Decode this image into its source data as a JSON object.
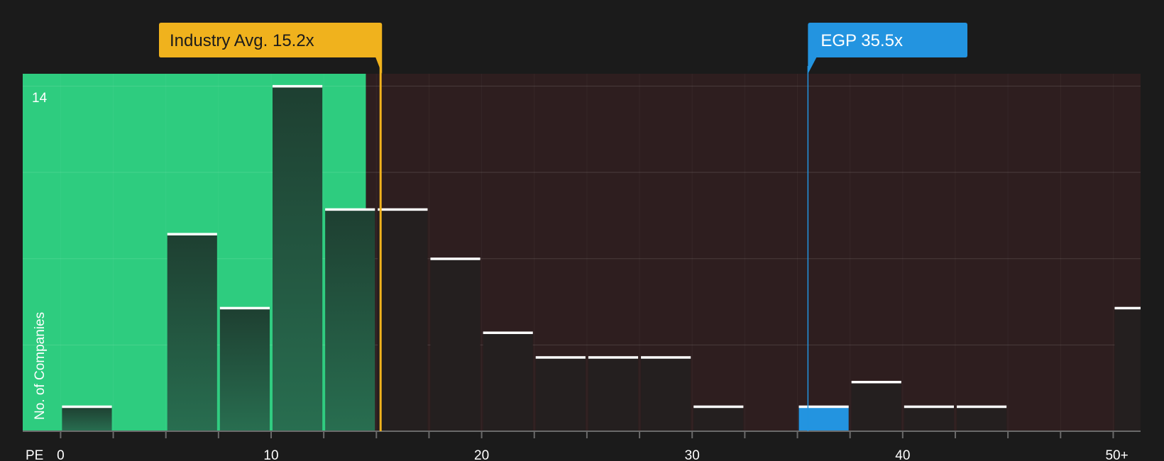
{
  "chart_data": {
    "type": "bar",
    "title": "",
    "xlabel": "PE",
    "ylabel": "No. of Companies",
    "x_ticks": [
      "0",
      "10",
      "20",
      "30",
      "40",
      "50+"
    ],
    "y_ticks": [
      "14"
    ],
    "ylim": [
      0,
      14.5
    ],
    "xlim": [
      -1.8,
      51.3
    ],
    "bin_width": 2.5,
    "bins": [
      {
        "start": 0,
        "value": 1
      },
      {
        "start": 2.5,
        "value": 0
      },
      {
        "start": 5,
        "value": 8
      },
      {
        "start": 7.5,
        "value": 5
      },
      {
        "start": 10,
        "value": 14
      },
      {
        "start": 12.5,
        "value": 9
      },
      {
        "start": 15,
        "value": 9
      },
      {
        "start": 17.5,
        "value": 7
      },
      {
        "start": 20,
        "value": 4
      },
      {
        "start": 22.5,
        "value": 3
      },
      {
        "start": 25,
        "value": 3
      },
      {
        "start": 27.5,
        "value": 3
      },
      {
        "start": 30,
        "value": 1
      },
      {
        "start": 32.5,
        "value": 0
      },
      {
        "start": 35,
        "value": 1,
        "highlight": true
      },
      {
        "start": 37.5,
        "value": 2
      },
      {
        "start": 40,
        "value": 1
      },
      {
        "start": 42.5,
        "value": 1
      },
      {
        "start": 45,
        "value": 0
      },
      {
        "start": 47.5,
        "value": 0
      },
      {
        "start": 50,
        "value": 5
      }
    ],
    "industry_avg": {
      "value": 15.2,
      "label": "Industry Avg. 15.2x"
    },
    "company": {
      "value": 35.5,
      "label": "EGP 35.5x"
    },
    "grid": true,
    "colors": {
      "background": "#1b1b1b",
      "good_zone": "#2ecc7f",
      "bad_zone": "#2e1e1f",
      "bar_in_good": "#1f4a37",
      "bar_in_bad": "#241f1f",
      "bar_cap": "#ffffff",
      "industry": "#f0b21d",
      "company": "#2394e0",
      "grid": "#4a3c3c"
    }
  }
}
